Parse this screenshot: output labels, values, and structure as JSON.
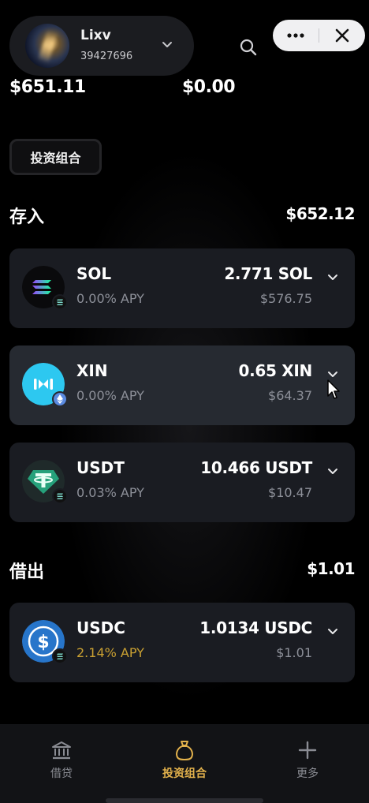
{
  "header": {
    "account_name": "Lixv",
    "account_id": "39427696",
    "icons": [
      "chevron-down-icon",
      "search-icon",
      "more-icon",
      "close-icon"
    ]
  },
  "balances": {
    "left": "$651.11",
    "right": "$0.00"
  },
  "portfolio_tag": "投资组合",
  "deposits": {
    "title": "存入",
    "total": "$652.12",
    "items": [
      {
        "symbol": "SOL",
        "apy": "0.00% APY",
        "amount": "2.771 SOL",
        "usd": "$576.75",
        "icon": "sol-icon",
        "chain": "solana-chain-icon"
      },
      {
        "symbol": "XIN",
        "apy": "0.00% APY",
        "amount": "0.65 XIN",
        "usd": "$64.37",
        "icon": "xin-icon",
        "chain": "ethereum-chain-icon"
      },
      {
        "symbol": "USDT",
        "apy": "0.03% APY",
        "amount": "10.466 USDT",
        "usd": "$10.47",
        "icon": "usdt-icon",
        "chain": "solana-chain-icon"
      }
    ]
  },
  "borrows": {
    "title": "借出",
    "total": "$1.01",
    "items": [
      {
        "symbol": "USDC",
        "apy": "2.14% APY",
        "amount": "1.0134 USDC",
        "usd": "$1.01",
        "icon": "usdc-icon",
        "chain": "solana-chain-icon"
      }
    ]
  },
  "bottom_nav": [
    {
      "label": "借贷",
      "icon": "bank-icon",
      "active": false
    },
    {
      "label": "投资组合",
      "icon": "bag-icon",
      "active": true
    },
    {
      "label": "更多",
      "icon": "plus-icon",
      "active": false
    }
  ],
  "colors": {
    "background": "#000000",
    "card": "#1a1c22",
    "card_hover": "#262a31",
    "muted_text": "#8d9099",
    "accent_gold": "#e3b24c",
    "apy_gold": "#c9a032"
  }
}
